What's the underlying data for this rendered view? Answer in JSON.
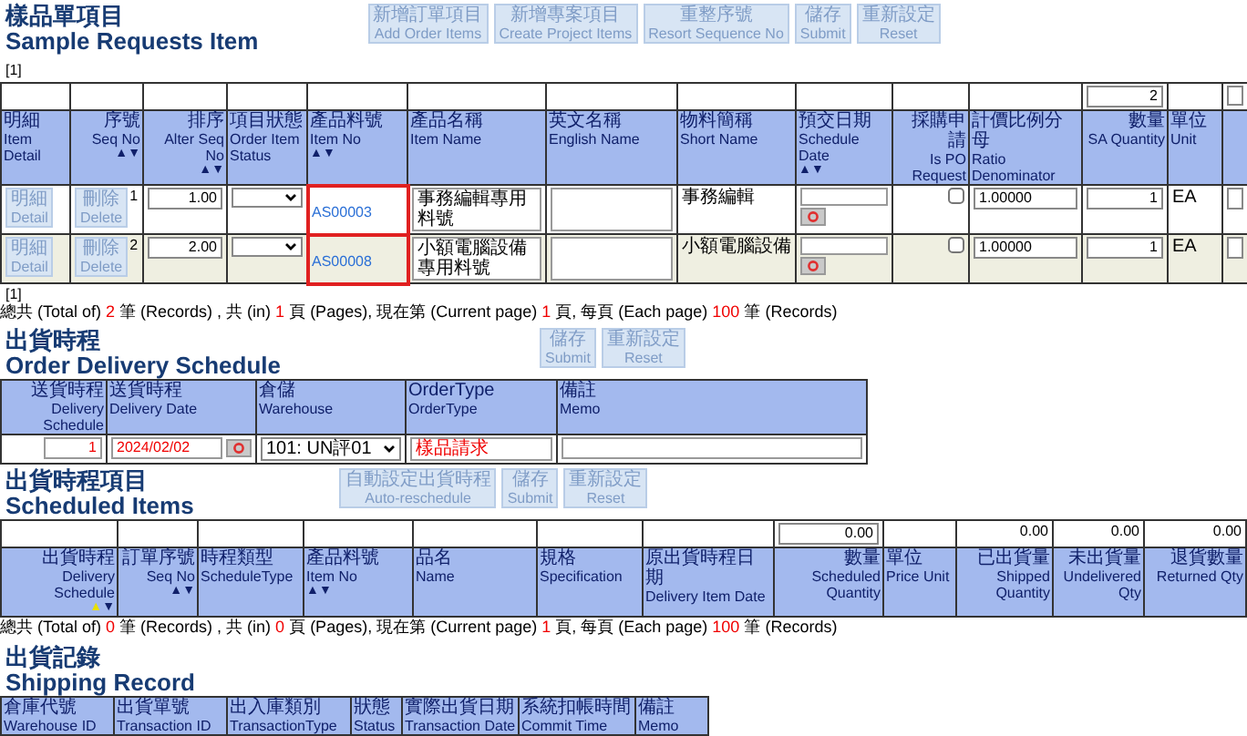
{
  "sample": {
    "title_zh": "樣品單項目",
    "title_en": "Sample Requests Item",
    "buttons": [
      {
        "zh": "新增訂單項目",
        "en": "Add Order Items"
      },
      {
        "zh": "新增專案項目",
        "en": "Create Project Items"
      },
      {
        "zh": "重整序號",
        "en": "Resort Sequence No"
      },
      {
        "zh": "儲存",
        "en": "Submit"
      },
      {
        "zh": "重新設定",
        "en": "Reset"
      }
    ],
    "pager": "[1]",
    "columns": [
      {
        "kind": "text",
        "zh": "明細",
        "en": "Item Detail",
        "highlighted": false
      },
      {
        "kind": "numeric",
        "zh": "序號",
        "en": "Seq No",
        "sort": [
          {
            "glyph": "▲",
            "selected": false
          },
          {
            "glyph": "▼",
            "selected": false
          }
        ],
        "highlighted": false
      },
      {
        "kind": "numeric",
        "zh": "排序",
        "en": "Alter Seq No",
        "sort": [
          {
            "glyph": "▲",
            "selected": false
          },
          {
            "glyph": "▼",
            "selected": false
          }
        ],
        "highlighted": false
      },
      {
        "kind": "text",
        "zh": "項目狀態",
        "en": "Order Item Status",
        "highlighted": false
      },
      {
        "kind": "text",
        "zh": "產品料號",
        "en": "Item No",
        "sort": [
          {
            "glyph": "▲",
            "selected": false
          },
          {
            "glyph": "▼",
            "selected": false
          }
        ],
        "highlighted": true
      },
      {
        "kind": "text",
        "zh": "產品名稱",
        "en": "Item Name",
        "highlighted": false
      },
      {
        "kind": "text",
        "zh": "英文名稱",
        "en": "English Name",
        "highlighted": false
      },
      {
        "kind": "text",
        "zh": "物料簡稱",
        "en": "Short Name",
        "highlighted": false
      },
      {
        "kind": "text",
        "zh": "預交日期",
        "en": "Schedule Date",
        "sort": [
          {
            "glyph": "▲",
            "selected": false
          },
          {
            "glyph": "▼",
            "selected": false
          }
        ],
        "highlighted": false
      },
      {
        "kind": "numeric",
        "zh": "採購申請",
        "en": "Is PO Request",
        "highlighted": false
      },
      {
        "kind": "text",
        "zh": "計價比例分母",
        "en": "Ratio Denominator",
        "highlighted": false
      },
      {
        "kind": "numeric",
        "zh": "數量",
        "en": "SA Quantity",
        "highlighted": false
      },
      {
        "kind": "text",
        "zh": "單位",
        "en": "Unit",
        "highlighted": false
      },
      {
        "kind": "blank",
        "highlighted": false
      }
    ],
    "filter": [
      {
        "kind": "blank"
      },
      {
        "kind": "blank"
      },
      {
        "kind": "blank"
      },
      {
        "kind": "blank"
      },
      {
        "kind": "blank"
      },
      {
        "kind": "blank"
      },
      {
        "kind": "blank"
      },
      {
        "kind": "blank"
      },
      {
        "kind": "blank"
      },
      {
        "kind": "blank"
      },
      {
        "kind": "blank"
      },
      {
        "kind": "number",
        "value": "2"
      },
      {
        "kind": "blank"
      },
      {
        "kind": "input"
      }
    ],
    "rows": [
      {
        "shaded": false,
        "cells": [
          {
            "kind": "detail",
            "zh": "明細",
            "en": "Detail"
          },
          {
            "kind": "delete_seq",
            "zh": "刪除",
            "en": "Delete",
            "seq": "1"
          },
          {
            "kind": "number",
            "value": "1.00"
          },
          {
            "kind": "select"
          },
          {
            "kind": "link",
            "text": "AS00003"
          },
          {
            "kind": "textarea",
            "value": "事務編輯專用料號"
          },
          {
            "kind": "textarea"
          },
          {
            "kind": "text",
            "text": "事務編輯"
          },
          {
            "kind": "date"
          },
          {
            "kind": "checkbox",
            "checked": false
          },
          {
            "kind": "input",
            "value": "1.00000"
          },
          {
            "kind": "number",
            "value": "1"
          },
          {
            "kind": "text",
            "text": "EA"
          },
          {
            "kind": "input"
          }
        ]
      },
      {
        "shaded": true,
        "cells": [
          {
            "kind": "detail",
            "zh": "明細",
            "en": "Detail"
          },
          {
            "kind": "delete_seq",
            "zh": "刪除",
            "en": "Delete",
            "seq": "2"
          },
          {
            "kind": "number",
            "value": "2.00"
          },
          {
            "kind": "select"
          },
          {
            "kind": "link",
            "text": "AS00008"
          },
          {
            "kind": "textarea",
            "value": "小額電腦設備專用料號"
          },
          {
            "kind": "textarea"
          },
          {
            "kind": "text",
            "text": "小額電腦設備"
          },
          {
            "kind": "date"
          },
          {
            "kind": "checkbox",
            "checked": false
          },
          {
            "kind": "input",
            "value": "1.00000"
          },
          {
            "kind": "number",
            "value": "1"
          },
          {
            "kind": "text",
            "text": "EA"
          },
          {
            "kind": "input"
          }
        ]
      }
    ],
    "pager_bottom": "[1]",
    "summary": [
      {
        "kind": "text",
        "text": "總共 (Total of) "
      },
      {
        "kind": "count",
        "text": "2"
      },
      {
        "kind": "text",
        "text": " 筆 (Records) , 共 (in) "
      },
      {
        "kind": "count",
        "text": "1"
      },
      {
        "kind": "text",
        "text": " 頁 (Pages), 現在第 (Current page) "
      },
      {
        "kind": "count",
        "text": "1"
      },
      {
        "kind": "text",
        "text": " 頁, 每頁 (Each page) "
      },
      {
        "kind": "count",
        "text": "100"
      },
      {
        "kind": "text",
        "text": " 筆 (Records)"
      }
    ]
  },
  "delivery": {
    "title_zh": "出貨時程",
    "title_en": "Order Delivery Schedule",
    "buttons": [
      {
        "zh": "儲存",
        "en": "Submit"
      },
      {
        "zh": "重新設定",
        "en": "Reset"
      }
    ],
    "columns": [
      {
        "kind": "numeric",
        "zh": "送貨時程",
        "en": "Delivery Schedule"
      },
      {
        "kind": "text",
        "zh": "送貨時程",
        "en": "Delivery Date"
      },
      {
        "kind": "text",
        "zh": "倉儲",
        "en": "Warehouse"
      },
      {
        "kind": "text",
        "zh": "OrderType",
        "en": "OrderType"
      },
      {
        "kind": "text",
        "zh": "備註",
        "en": "Memo"
      }
    ],
    "row": [
      {
        "kind": "number_red",
        "value": "1"
      },
      {
        "kind": "date",
        "value": "2024/02/02"
      },
      {
        "kind": "select",
        "value": "101: UN評01"
      },
      {
        "kind": "input_red",
        "value": "樣品請求"
      },
      {
        "kind": "input"
      }
    ]
  },
  "scheduled": {
    "title_zh": "出貨時程項目",
    "title_en": "Scheduled Items",
    "buttons": [
      {
        "zh": "自動設定出貨時程",
        "en": "Auto-reschedule"
      },
      {
        "zh": "儲存",
        "en": "Submit"
      },
      {
        "zh": "重新設定",
        "en": "Reset"
      }
    ],
    "columns": [
      {
        "kind": "numeric",
        "zh": "出貨時程",
        "en": "Delivery Schedule",
        "sort": [
          {
            "glyph": "▲",
            "selected": true
          },
          {
            "glyph": "▼",
            "selected": false
          }
        ]
      },
      {
        "kind": "numeric",
        "zh": "訂單序號",
        "en": "Seq No",
        "sort": [
          {
            "glyph": "▲",
            "selected": false
          },
          {
            "glyph": "▼",
            "selected": false
          }
        ]
      },
      {
        "kind": "text",
        "zh": "時程類型",
        "en": "ScheduleType"
      },
      {
        "kind": "text",
        "zh": "產品料號",
        "en": "Item No",
        "sort": [
          {
            "glyph": "▲",
            "selected": false
          },
          {
            "glyph": "▼",
            "selected": false
          }
        ]
      },
      {
        "kind": "text",
        "zh": "品名",
        "en": "Name"
      },
      {
        "kind": "text",
        "zh": "規格",
        "en": "Specification"
      },
      {
        "kind": "text",
        "zh": "原出貨時程日期",
        "en": "Delivery Item Date"
      },
      {
        "kind": "numeric",
        "zh": "數量",
        "en": "Scheduled Quantity"
      },
      {
        "kind": "text",
        "zh": "單位",
        "en": "Price Unit"
      },
      {
        "kind": "numeric",
        "zh": "已出貨量",
        "en": "Shipped Quantity"
      },
      {
        "kind": "numeric",
        "zh": "未出貨量",
        "en": "Undelivered Qty"
      },
      {
        "kind": "numeric",
        "zh": "退貨數量",
        "en": "Returned Qty"
      }
    ],
    "filter": [
      {
        "kind": "blank"
      },
      {
        "kind": "blank"
      },
      {
        "kind": "blank"
      },
      {
        "kind": "blank"
      },
      {
        "kind": "blank"
      },
      {
        "kind": "blank"
      },
      {
        "kind": "blank"
      },
      {
        "kind": "number",
        "value": "0.00"
      },
      {
        "kind": "blank"
      },
      {
        "kind": "total",
        "value": "0.00"
      },
      {
        "kind": "total",
        "value": "0.00"
      },
      {
        "kind": "total",
        "value": "0.00"
      }
    ],
    "summary": [
      {
        "kind": "text",
        "text": "總共 (Total of) "
      },
      {
        "kind": "count",
        "text": "0"
      },
      {
        "kind": "text",
        "text": " 筆 (Records) , 共 (in) "
      },
      {
        "kind": "count",
        "text": "0"
      },
      {
        "kind": "text",
        "text": " 頁 (Pages), 現在第 (Current page) "
      },
      {
        "kind": "count",
        "text": "1"
      },
      {
        "kind": "text",
        "text": " 頁, 每頁 (Each page) "
      },
      {
        "kind": "count",
        "text": "100"
      },
      {
        "kind": "text",
        "text": " 筆 (Records)"
      }
    ]
  },
  "shipping": {
    "title_zh": "出貨記錄",
    "title_en": "Shipping Record",
    "columns": [
      {
        "zh": "倉庫代號",
        "en": "Warehouse ID"
      },
      {
        "zh": "出貨單號",
        "en": "Transaction ID"
      },
      {
        "zh": "出入庫類別",
        "en": "TransactionType"
      },
      {
        "zh": "狀態",
        "en": "Status"
      },
      {
        "zh": "實際出貨日期",
        "en": "Transaction Date"
      },
      {
        "zh": "系統扣帳時間",
        "en": "Commit Time"
      },
      {
        "zh": "備註",
        "en": "Memo"
      }
    ]
  }
}
